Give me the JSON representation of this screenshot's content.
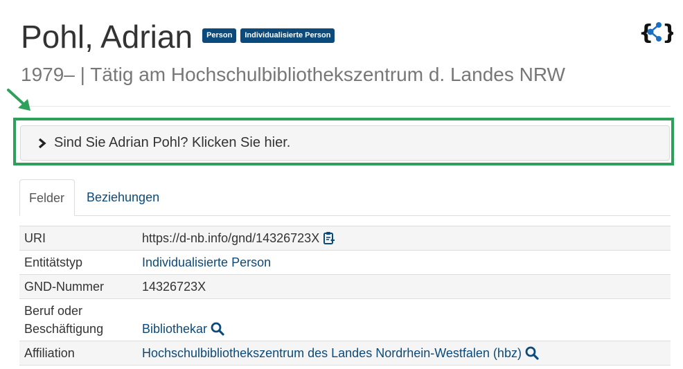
{
  "header": {
    "title": "Pohl, Adrian",
    "badges": [
      "Person",
      "Individualisierte Person"
    ],
    "subtitle": "1979– | Tätig am Hochschulbibliothekszentrum d. Landes NRW",
    "logo_icon": "lobid-share-logo-icon"
  },
  "claim": {
    "text": "Sind Sie Adrian Pohl? Klicken Sie hier."
  },
  "tabs": [
    {
      "label": "Felder",
      "active": true
    },
    {
      "label": "Beziehungen",
      "active": false
    }
  ],
  "fields": {
    "uri": {
      "label": "URI",
      "value": "https://d-nb.info/gnd/14326723X"
    },
    "entity_type": {
      "label": "Entitätstyp",
      "value": "Individualisierte Person"
    },
    "gnd_number": {
      "label": "GND-Nummer",
      "value": "14326723X"
    },
    "occupation": {
      "label_line1": "Beruf oder",
      "label_line2": "Beschäftigung",
      "value": "Bibliothekar"
    },
    "affiliation": {
      "label": "Affiliation",
      "value": "Hochschulbibliothekszentrum des Landes Nordrhein-Westfalen (hbz)"
    }
  },
  "colors": {
    "brand": "#0b4a7a",
    "highlight": "#2fa05c",
    "text": "#333333",
    "muted": "#777777"
  }
}
